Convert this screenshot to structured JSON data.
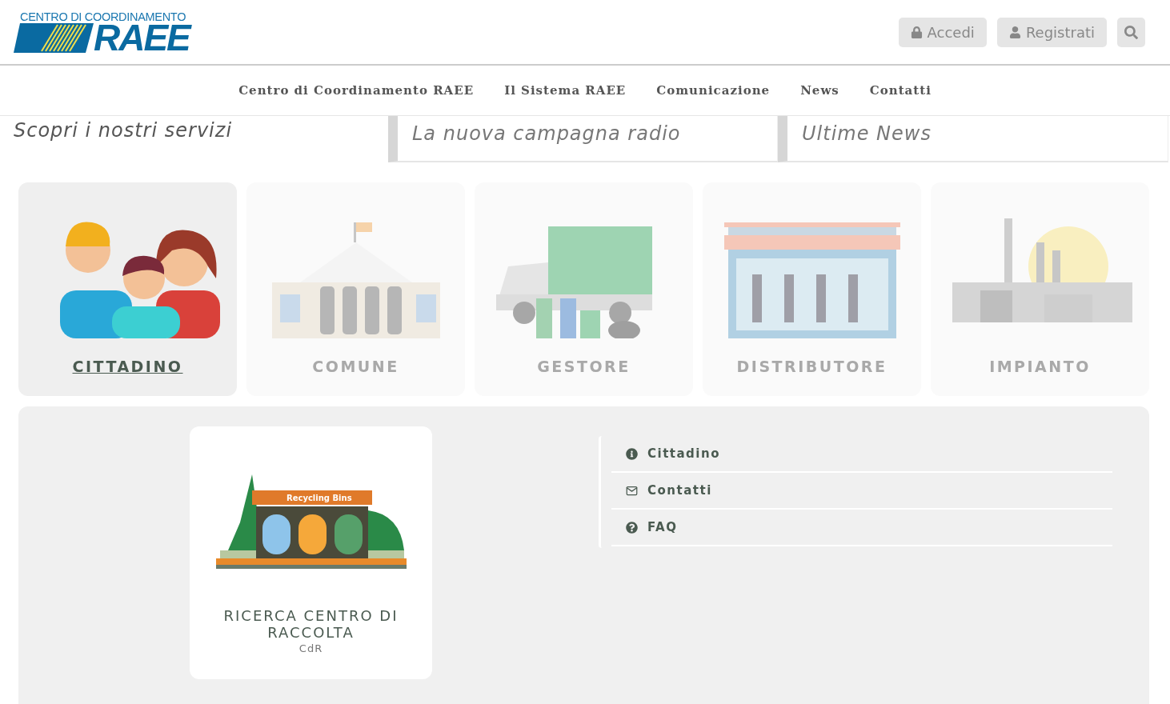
{
  "logo": {
    "top": "CENTRO DI COORDINAMENTO",
    "main": "RAEE"
  },
  "header_buttons": [
    {
      "kind": "lock",
      "label": "Accedi"
    },
    {
      "kind": "user",
      "label": "Registrati"
    },
    {
      "kind": "search"
    }
  ],
  "nav": [
    "Centro di Coordinamento RAEE",
    "Il Sistema RAEE",
    "Comunicazione",
    "News",
    "Contatti"
  ],
  "tabs": [
    {
      "label": "Scopri i nostri servizi",
      "selected": true
    },
    {
      "label": "La nuova campagna radio",
      "selected": false
    },
    {
      "label": "Ultime News",
      "selected": false
    }
  ],
  "services": [
    {
      "kind": "people",
      "label": "CITTADINO",
      "selected": true
    },
    {
      "kind": "townhall",
      "label": "COMUNE",
      "selected": false
    },
    {
      "kind": "truck",
      "label": "GESTORE",
      "selected": false
    },
    {
      "kind": "shop",
      "label": "DISTRIBUTORE",
      "selected": false
    },
    {
      "kind": "factory",
      "label": "IMPIANTO",
      "selected": false
    }
  ],
  "feature_card": {
    "sign": "Recycling Bins",
    "title": "RICERCA CENTRO DI RACCOLTA",
    "subtitle": "CdR"
  },
  "links": [
    {
      "kind": "info",
      "label": "Cittadino"
    },
    {
      "kind": "mail",
      "label": "Contatti"
    },
    {
      "kind": "question",
      "label": "FAQ"
    }
  ]
}
